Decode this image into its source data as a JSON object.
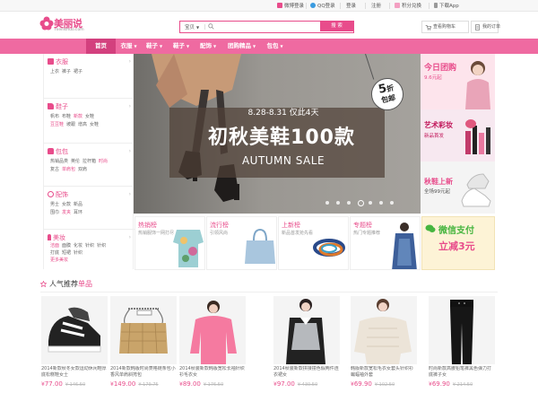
{
  "topbar": {
    "weibo_login": "微博登录",
    "qq_login": "QQ登录",
    "login": "登录",
    "register": "注册",
    "points": "积分兑换",
    "download_app": "下载App"
  },
  "logo": {
    "name": "美丽说",
    "domain": "meilishuo.com"
  },
  "search": {
    "type": "宝贝",
    "button": "搜 索"
  },
  "header_links": {
    "cart": "查看购物车",
    "orders": "我的订单"
  },
  "nav": [
    "首页",
    "衣服",
    "鞋子",
    "配饰",
    "团购精品",
    "包包"
  ],
  "nav_partial": "鞋子",
  "sidebar": [
    {
      "title": "衣服",
      "rows": [
        [
          "上衣",
          "裤子",
          "裙子"
        ]
      ]
    },
    {
      "title": "鞋子",
      "rows": [
        [
          "帆布",
          "布鞋",
          "新款",
          "女鞋"
        ],
        [
          "豆豆鞋",
          "坡跟",
          "增高",
          "女鞋"
        ]
      ]
    },
    {
      "title": "包包",
      "rows": [
        [
          "热销品类",
          "英伦",
          "拉杆箱",
          "时尚"
        ],
        [
          "复古",
          "单肩包",
          "双肩"
        ]
      ]
    },
    {
      "title": "配饰",
      "rows": [
        [
          "男士",
          "女款",
          "新品"
        ],
        [
          "围巾",
          "发夹",
          "耳环"
        ]
      ]
    },
    {
      "title": "美妆",
      "rows": [
        [
          "洁面",
          "面膜",
          "化妆",
          "针织",
          "针织"
        ],
        [
          "打底",
          "短裙",
          "针织"
        ],
        [
          "更多美妆"
        ]
      ]
    }
  ],
  "banner": {
    "date": "8.28-8.31 仅此4天",
    "headline": "初秋美鞋100款",
    "sub": "AUTUMN SALE",
    "tag_num": "5",
    "tag_unit": "折",
    "tag_text": "包邮",
    "slides": 7,
    "active_slide": 3
  },
  "promos": [
    {
      "title": "今日团购",
      "sub": "9.6元起"
    },
    {
      "title": "艺术彩妆",
      "sub": "新品首发"
    },
    {
      "title": "秋鞋上新",
      "sub": "全场99元起"
    }
  ],
  "features": [
    {
      "title": "热销榜",
      "sub": "热销服饰一网打尽"
    },
    {
      "title": "流行榜",
      "sub": "引领风尚"
    },
    {
      "title": "上新榜",
      "sub": "新品首发抢先看"
    },
    {
      "title": "专题榜",
      "sub": "热门专题推荐"
    }
  ],
  "pay_promo": {
    "line1": "微信支付",
    "line2": "立减3元"
  },
  "popular": {
    "prefix": "人气推荐",
    "suffix": "单品"
  },
  "products": [
    {
      "desc": "2014新款秋冬女款运动休闲鞋厚底松糕鞋女士",
      "currency": "¥",
      "price": "77.00",
      "old": "¥ 146.50"
    },
    {
      "desc": "2014新款韩版时尚菱格链条包小香风单肩斜挎包",
      "currency": "¥",
      "price": "149.00",
      "old": "¥ 179.75"
    },
    {
      "desc": "2014秋装新款韩版宽松长袖针织衫毛衣女",
      "currency": "¥",
      "price": "89.00",
      "old": "¥ 176.50"
    },
    {
      "desc": "2014秋装新款拼接撞色假两件连衣裙女",
      "currency": "¥",
      "price": "97.00",
      "old": "¥ 430.50"
    },
    {
      "desc": "韩版新款宽松毛衣女套头针织衫蝙蝠袖外套",
      "currency": "¥",
      "price": "69.90",
      "old": "¥ 102.50"
    },
    {
      "desc": "时尚新款高腰铅笔裤黑色弹力打底裤子女",
      "currency": "¥",
      "price": "69.90",
      "old": "¥ 214.50"
    }
  ]
}
